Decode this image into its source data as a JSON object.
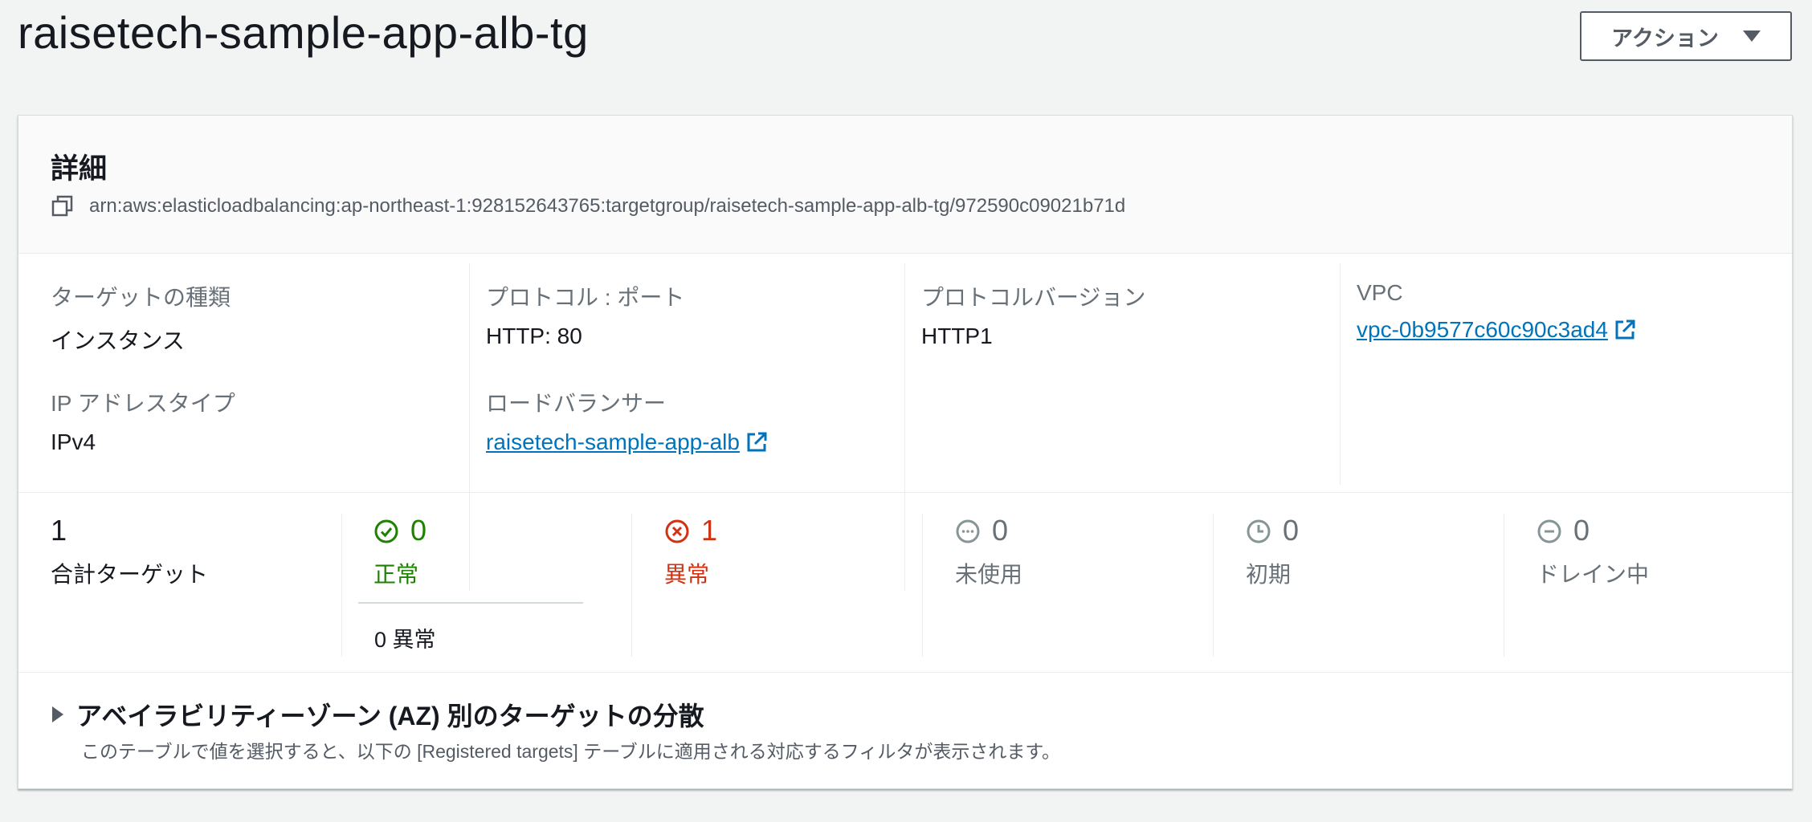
{
  "header": {
    "title": "raisetech-sample-app-alb-tg",
    "action_label": "アクション"
  },
  "details": {
    "title": "詳細",
    "arn": "arn:aws:elasticloadbalancing:ap-northeast-1:928152643765:targetgroup/raisetech-sample-app-alb-tg/972590c09021b71d",
    "target_type": {
      "label": "ターゲットの種類",
      "value": "インスタンス"
    },
    "ip_type": {
      "label": "IP アドレスタイプ",
      "value": "IPv4"
    },
    "protocol_port": {
      "label": "プロトコル : ポート",
      "value": "HTTP: 80"
    },
    "load_balancer": {
      "label": "ロードバランサー",
      "value": "raisetech-sample-app-alb"
    },
    "protocol_version": {
      "label": "プロトコルバージョン",
      "value": "HTTP1"
    },
    "vpc": {
      "label": "VPC",
      "value": "vpc-0b9577c60c90c3ad4"
    }
  },
  "stats": {
    "total": {
      "count": "1",
      "label": "合計ターゲット"
    },
    "healthy": {
      "count": "0",
      "label": "正常",
      "sub": "0 異常",
      "color": "#1d8102"
    },
    "unhealthy": {
      "count": "1",
      "label": "異常",
      "color": "#d13212"
    },
    "unused": {
      "count": "0",
      "label": "未使用",
      "color": "#687078"
    },
    "initial": {
      "count": "0",
      "label": "初期",
      "color": "#687078"
    },
    "draining": {
      "count": "0",
      "label": "ドレイン中",
      "color": "#687078"
    }
  },
  "az_section": {
    "title": "アベイラビリティーゾーン (AZ) 別のターゲットの分散",
    "description": "このテーブルで値を選択すると、以下の [Registered targets] テーブルに適用される対応するフィルタが表示されます。"
  },
  "colors": {
    "link": "#0073bb",
    "healthy": "#1d8102",
    "unhealthy": "#d13212",
    "neutral": "#687078"
  }
}
